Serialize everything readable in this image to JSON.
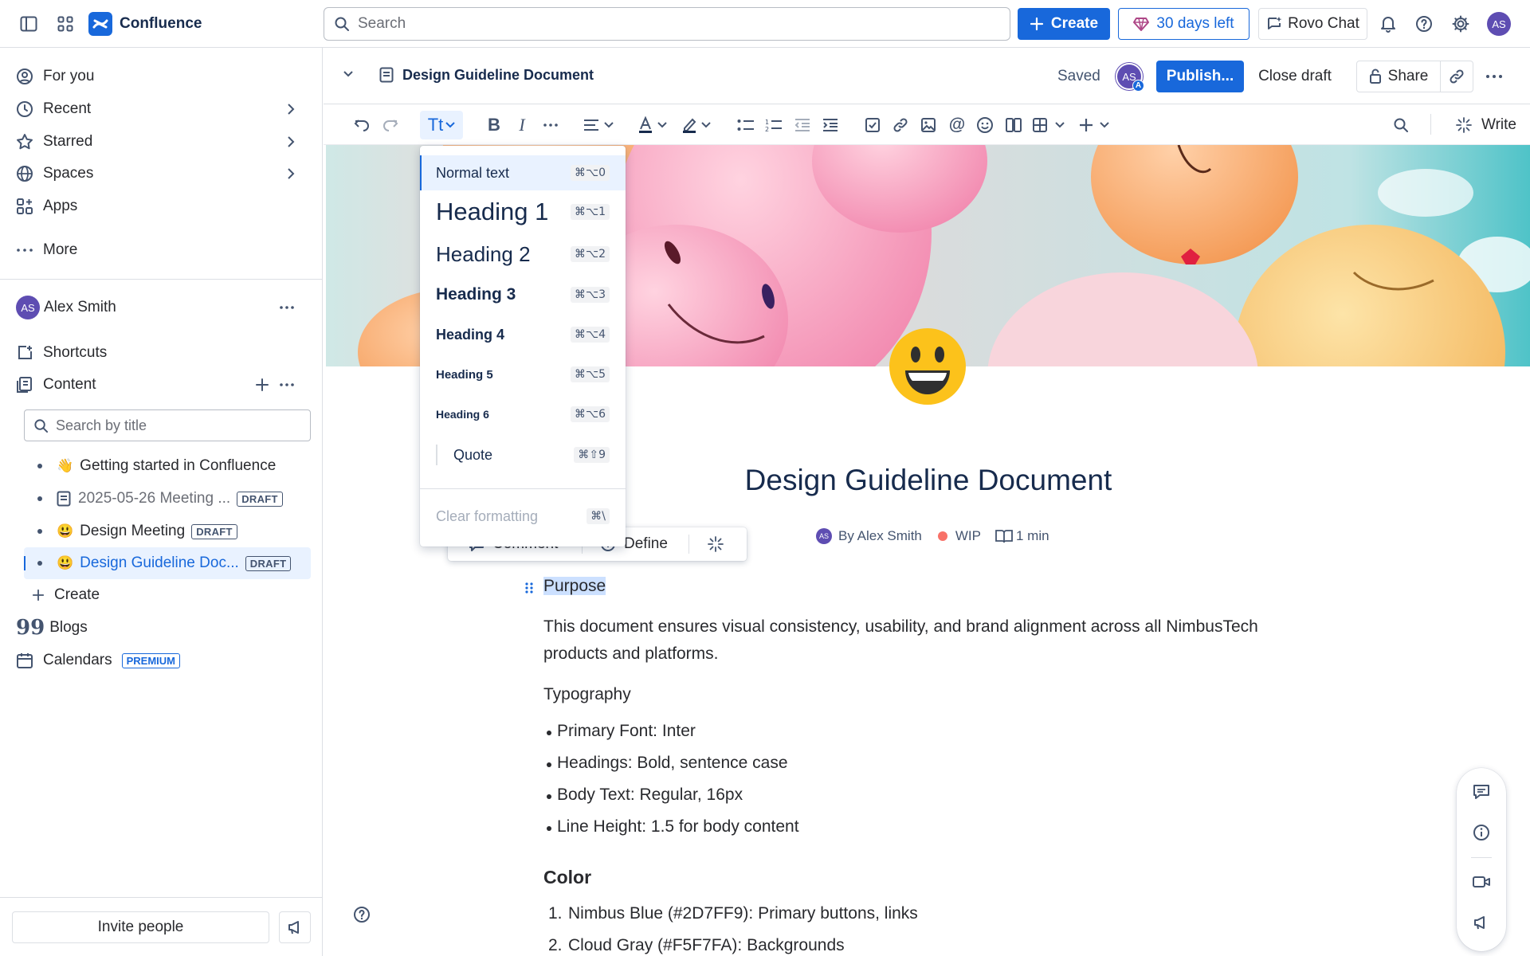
{
  "app": {
    "name": "Confluence"
  },
  "colors": {
    "brand": "#0c66e4",
    "text": "#172b4d",
    "subtle": "#44546f",
    "avatar": "#5e4db2",
    "selected_bg": "#e9f2ff",
    "highlight": "#cce0ff"
  },
  "topbar": {
    "search_placeholder": "Search",
    "create_label": "Create",
    "trial_label": "30 days left",
    "rovo_label": "Rovo Chat",
    "avatar_initials": "AS"
  },
  "sidebar": {
    "nav": [
      {
        "label": "For you",
        "icon": "user-circle-icon"
      },
      {
        "label": "Recent",
        "icon": "clock-icon"
      },
      {
        "label": "Starred",
        "icon": "star-icon"
      },
      {
        "label": "Spaces",
        "icon": "globe-icon"
      },
      {
        "label": "Apps",
        "icon": "apps-icon"
      }
    ],
    "more_label": "More",
    "space": {
      "initials": "AS",
      "name": "Alex Smith"
    },
    "shortcuts_label": "Shortcuts",
    "content_label": "Content",
    "search_placeholder": "Search by title",
    "tree": [
      {
        "emoji": "👋",
        "title": "Getting started in Confluence",
        "badge": ""
      },
      {
        "emoji": "page",
        "title": "2025-05-26 Meeting ...",
        "badge": "DRAFT"
      },
      {
        "emoji": "😃",
        "title": "Design Meeting",
        "badge": "DRAFT"
      },
      {
        "emoji": "😃",
        "title": "Design Guideline Doc...",
        "badge": "DRAFT"
      }
    ],
    "create_label": "Create",
    "blogs_label": "Blogs",
    "calendars_label": "Calendars",
    "premium_label": "PREMIUM",
    "invite_label": "Invite people"
  },
  "page_header": {
    "title": "Design Guideline Document",
    "saved_label": "Saved",
    "avatar_initials": "AS",
    "avatar_badge": "A",
    "publish_label": "Publish...",
    "close_draft_label": "Close draft",
    "share_label": "Share"
  },
  "toolbar": {
    "write_label": "Write",
    "text_style_label": "Tt"
  },
  "text_style_menu": {
    "items": [
      {
        "label": "Normal text",
        "shortcut": "⌘⌥0"
      },
      {
        "label": "Heading 1",
        "shortcut": "⌘⌥1"
      },
      {
        "label": "Heading 2",
        "shortcut": "⌘⌥2"
      },
      {
        "label": "Heading 3",
        "shortcut": "⌘⌥3"
      },
      {
        "label": "Heading 4",
        "shortcut": "⌘⌥4"
      },
      {
        "label": "Heading 5",
        "shortcut": "⌘⌥5"
      },
      {
        "label": "Heading 6",
        "shortcut": "⌘⌥6"
      },
      {
        "label": "Quote",
        "shortcut": "⌘⇧9"
      }
    ],
    "clear_label": "Clear formatting",
    "clear_shortcut": "⌘\\"
  },
  "selection_toolbar": {
    "comment_label": "Comment",
    "define_label": "Define"
  },
  "document": {
    "emoji": "😃",
    "title": "Design Guideline Document",
    "byline": "By Alex Smith",
    "status": "WIP",
    "status_color": "#f87168",
    "read_time": "1 min",
    "purpose_heading": "Purpose",
    "purpose_text_1": "This document ensures visual consistency, usability, and brand alignment across all NimbusTech",
    "purpose_text_2": "products and platforms.",
    "typography_heading": "Typography",
    "typography_items": [
      "Primary Font: Inter",
      "Headings: Bold, sentence case",
      "Body Text: Regular, 16px",
      "Line Height: 1.5 for body content"
    ],
    "color_heading": "Color",
    "color_items": [
      "Nimbus Blue (#2D7FF9): Primary buttons, links",
      "Cloud Gray (#F5F7FA): Backgrounds"
    ]
  }
}
